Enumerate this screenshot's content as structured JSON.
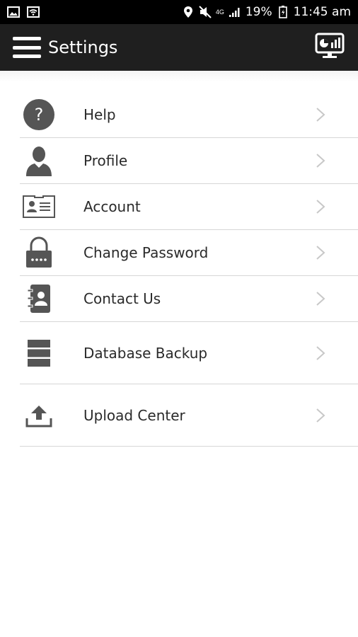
{
  "status_bar": {
    "battery": "19%",
    "time": "11:45 am",
    "network": "4G"
  },
  "app_bar": {
    "title": "Settings"
  },
  "settings": {
    "items": [
      {
        "label": "Help",
        "icon": "help-icon"
      },
      {
        "label": "Profile",
        "icon": "profile-icon"
      },
      {
        "label": "Account",
        "icon": "id-card-icon"
      },
      {
        "label": "Change Password",
        "icon": "lock-icon"
      },
      {
        "label": "Contact Us",
        "icon": "address-book-icon"
      },
      {
        "label": "Database Backup",
        "icon": "database-icon"
      },
      {
        "label": "Upload Center",
        "icon": "upload-icon"
      }
    ]
  },
  "colors": {
    "app_bar": "#1f1f1f",
    "status_bar": "#000000",
    "icon": "#555555",
    "divider": "#d6d6d6",
    "chevron": "#c8c8c8"
  }
}
